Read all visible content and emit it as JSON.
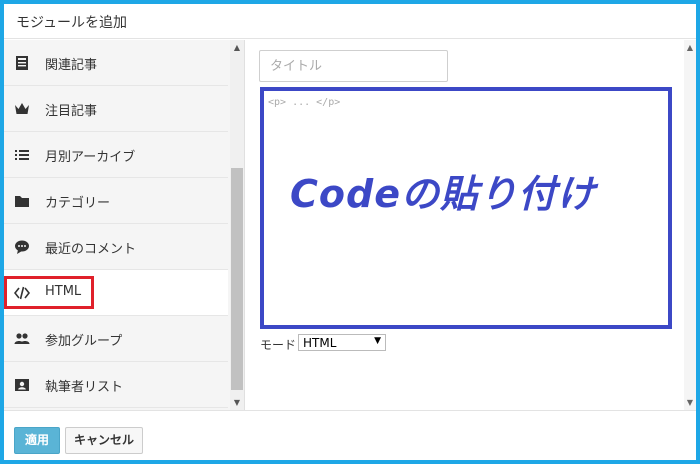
{
  "window": {
    "title": "モジュールを追加"
  },
  "sidebar": {
    "items": [
      {
        "label": "関連記事",
        "icon": "article-icon"
      },
      {
        "label": "注目記事",
        "icon": "crown-icon"
      },
      {
        "label": "月別アーカイブ",
        "icon": "list-icon"
      },
      {
        "label": "カテゴリー",
        "icon": "folder-icon"
      },
      {
        "label": "最近のコメント",
        "icon": "comment-icon"
      },
      {
        "label": "HTML",
        "icon": "code-icon",
        "selected": true
      },
      {
        "label": "参加グループ",
        "icon": "group-icon"
      },
      {
        "label": "執筆者リスト",
        "icon": "author-card-icon"
      }
    ]
  },
  "main": {
    "title_placeholder": "タイトル",
    "code_placeholder": "<p> ... </p>",
    "overlay_text": "Codeの貼り付け",
    "mode_label": "モード",
    "mode_value": "HTML"
  },
  "footer": {
    "apply_label": "適用",
    "cancel_label": "キャンセル"
  },
  "colors": {
    "frame_border": "#1ea7e6",
    "highlight_red": "#e0202a",
    "code_box_blue": "#3c48c6",
    "apply_button": "#5ab4d6"
  }
}
